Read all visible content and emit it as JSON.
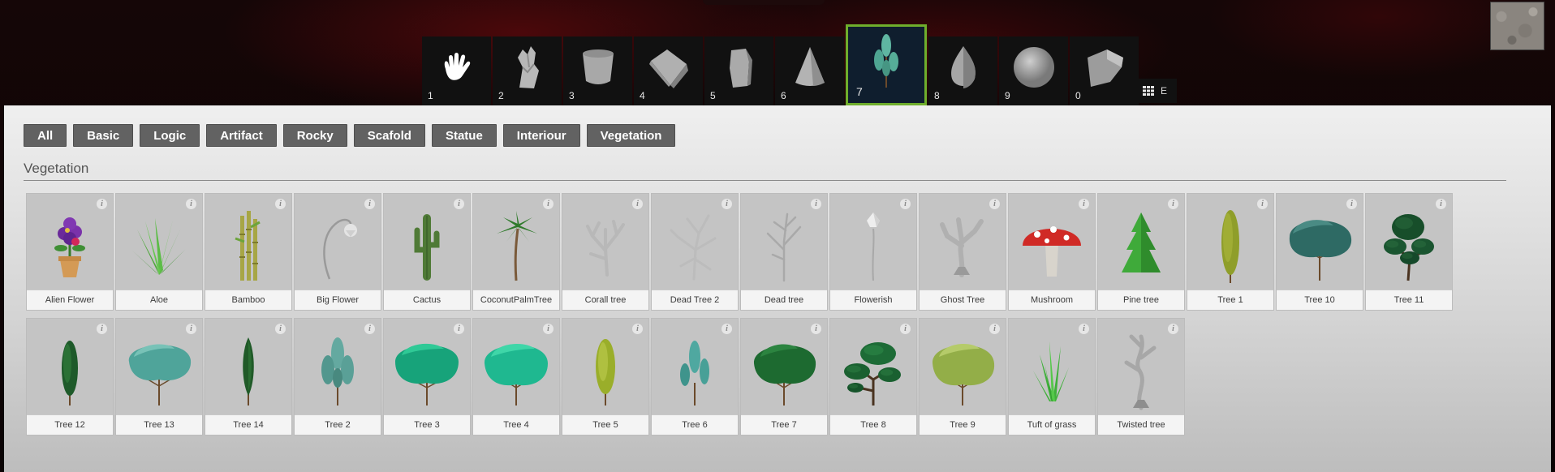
{
  "hotbar": {
    "slots": [
      {
        "num": "1",
        "icon": "hand-icon"
      },
      {
        "num": "2",
        "icon": "statue-icon"
      },
      {
        "num": "3",
        "icon": "cylinder-icon"
      },
      {
        "num": "4",
        "icon": "cube-icon"
      },
      {
        "num": "5",
        "icon": "rock-block-icon"
      },
      {
        "num": "6",
        "icon": "cone-icon"
      },
      {
        "num": "7",
        "icon": "sapling-icon",
        "active": true
      },
      {
        "num": "8",
        "icon": "teardrop-rock-icon"
      },
      {
        "num": "9",
        "icon": "sphere-icon"
      },
      {
        "num": "0",
        "icon": "wedge-icon"
      }
    ],
    "grid_toggle_key": "E"
  },
  "filters": [
    "All",
    "Basic",
    "Logic",
    "Artifact",
    "Rocky",
    "Scafold",
    "Statue",
    "Interiour",
    "Vegetation"
  ],
  "section_title": "Vegetation",
  "items_row1": [
    {
      "label": "Alien Flower",
      "icon": "alien-flower-icon"
    },
    {
      "label": "Aloe",
      "icon": "aloe-icon"
    },
    {
      "label": "Bamboo",
      "icon": "bamboo-icon"
    },
    {
      "label": "Big Flower",
      "icon": "big-flower-icon"
    },
    {
      "label": "Cactus",
      "icon": "cactus-icon"
    },
    {
      "label": "CoconutPalmTree",
      "icon": "palm-tree-icon"
    },
    {
      "label": "Corall tree",
      "icon": "corall-tree-icon"
    },
    {
      "label": "Dead Tree 2",
      "icon": "dead-tree-2-icon"
    },
    {
      "label": "Dead tree",
      "icon": "dead-tree-icon"
    },
    {
      "label": "Flowerish",
      "icon": "flowerish-icon"
    },
    {
      "label": "Ghost Tree",
      "icon": "ghost-tree-icon"
    },
    {
      "label": "Mushroom",
      "icon": "mushroom-icon"
    },
    {
      "label": "Pine tree",
      "icon": "pine-tree-icon"
    },
    {
      "label": "Tree 1",
      "icon": "tree-1-icon"
    },
    {
      "label": "Tree 10",
      "icon": "tree-10-icon"
    },
    {
      "label": "Tree 11",
      "icon": "tree-11-icon"
    }
  ],
  "items_row2": [
    {
      "label": "Tree 12",
      "icon": "tree-12-icon"
    },
    {
      "label": "Tree 13",
      "icon": "tree-13-icon"
    },
    {
      "label": "Tree 14",
      "icon": "tree-14-icon"
    },
    {
      "label": "Tree 2",
      "icon": "tree-2-icon"
    },
    {
      "label": "Tree 3",
      "icon": "tree-3-icon"
    },
    {
      "label": "Tree 4",
      "icon": "tree-4-icon"
    },
    {
      "label": "Tree 5",
      "icon": "tree-5-icon"
    },
    {
      "label": "Tree 6",
      "icon": "tree-6-icon"
    },
    {
      "label": "Tree 7",
      "icon": "tree-7-icon"
    },
    {
      "label": "Tree 8",
      "icon": "tree-8-icon"
    },
    {
      "label": "Tree 9",
      "icon": "tree-9-icon"
    },
    {
      "label": "Tuft of grass",
      "icon": "grass-icon"
    },
    {
      "label": "Twisted tree",
      "icon": "twisted-tree-icon"
    }
  ],
  "colors": {
    "active_slot_border": "#6fae2c",
    "filter_button_bg": "#626262"
  }
}
